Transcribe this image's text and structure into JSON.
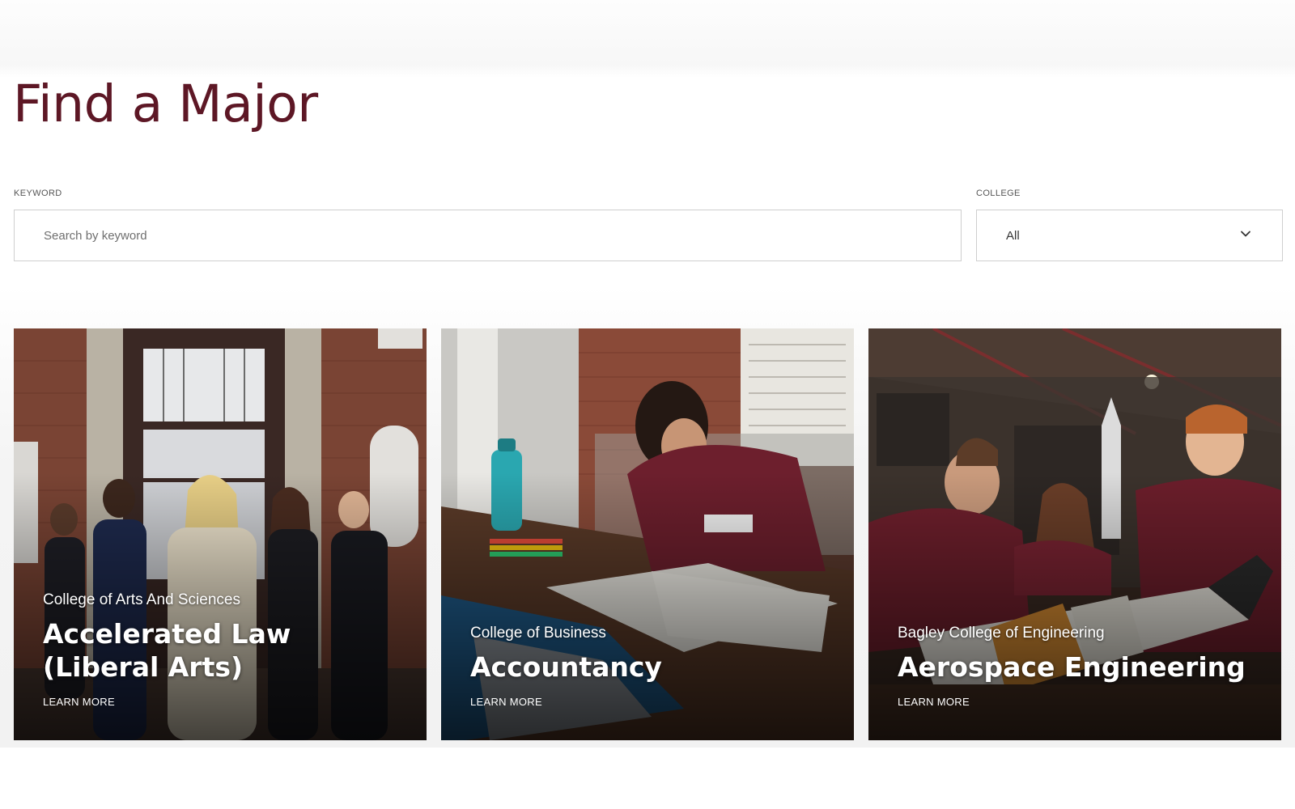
{
  "page": {
    "title": "Find a Major"
  },
  "filters": {
    "keyword_label": "KEYWORD",
    "keyword_placeholder": "Search by keyword",
    "keyword_value": "",
    "college_label": "COLLEGE",
    "college_selected": "All"
  },
  "cards": [
    {
      "college": "College of Arts And Sciences",
      "major": "Accelerated Law (Liberal Arts)",
      "link": "LEARN MORE",
      "image": "group-of-students-in-front-of-brick-building"
    },
    {
      "college": "College of Business",
      "major": "Accountancy",
      "link": "LEARN MORE",
      "image": "student-writing-in-notebook-at-desk"
    },
    {
      "college": "Bagley College of Engineering",
      "major": "Aerospace Engineering",
      "link": "LEARN MORE",
      "image": "students-working-on-rocket-in-lab"
    }
  ],
  "icons": {
    "select_chevron": "chevron-down-icon"
  },
  "colors": {
    "brand_maroon": "#5d1725",
    "card_text": "#ffffff",
    "input_border": "#cfcfcf"
  }
}
